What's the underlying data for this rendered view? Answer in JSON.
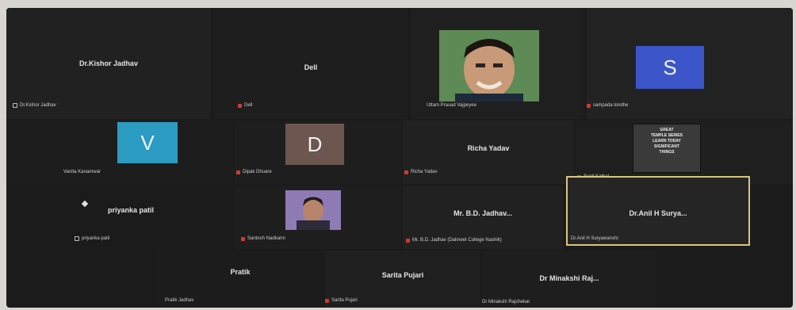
{
  "participants": [
    {
      "id": "p1",
      "name": "Dr.Kishor Jadhav",
      "label": "Dr.Kishor Jadhav",
      "muted": true
    },
    {
      "id": "p2",
      "name": "Dell",
      "label": "Dell",
      "muted": true
    },
    {
      "id": "p3",
      "name": "",
      "label": "Uttam Prasad Vajpeyee",
      "muted": false
    },
    {
      "id": "p4",
      "name": "S",
      "label": "sampada londhe",
      "muted": true,
      "avatar_color": "#3c55c8"
    },
    {
      "id": "p5",
      "name": "V",
      "label": "Vanita Kanamwar",
      "muted": false,
      "avatar_color": "#2b9bc2"
    },
    {
      "id": "p6",
      "name": "D",
      "label": "Dipak Dhuare",
      "muted": true,
      "avatar_color": "#6d5650"
    },
    {
      "id": "p7",
      "name": "Richa Yadav",
      "label": "Richa Yadav",
      "muted": true
    },
    {
      "id": "p8",
      "name": "",
      "label": "Sunil Kathal",
      "muted": true
    },
    {
      "id": "p9",
      "name": "priyanka patil",
      "label": "priyanka patil",
      "muted": true
    },
    {
      "id": "p10",
      "name": "",
      "label": "Santosh Nadkarni",
      "muted": true
    },
    {
      "id": "p11",
      "name": "Mr. B.D. Jadhav...",
      "label": "Mr. B.D. Jadhav (Dalmeet College Nashik)",
      "muted": true
    },
    {
      "id": "p12",
      "name": "Dr.Anil H Surya...",
      "label": "Dr.Anil H Suryawanshi",
      "muted": false
    },
    {
      "id": "p13",
      "name": "Pratik",
      "label": "Pratik Jadhav",
      "muted": false
    },
    {
      "id": "p14",
      "name": "Sarita Pujari",
      "label": "Sarita Pujari",
      "muted": true
    },
    {
      "id": "p15",
      "name": "Dr Minakshi Raj...",
      "label": "Dr Minakshi Rajshekar",
      "muted": false
    }
  ],
  "poster": {
    "lines": [
      "GREAT",
      "TEMPLE SERIES",
      "LEARN TODAY",
      "SIGNIFICANT",
      "THINGS"
    ]
  }
}
